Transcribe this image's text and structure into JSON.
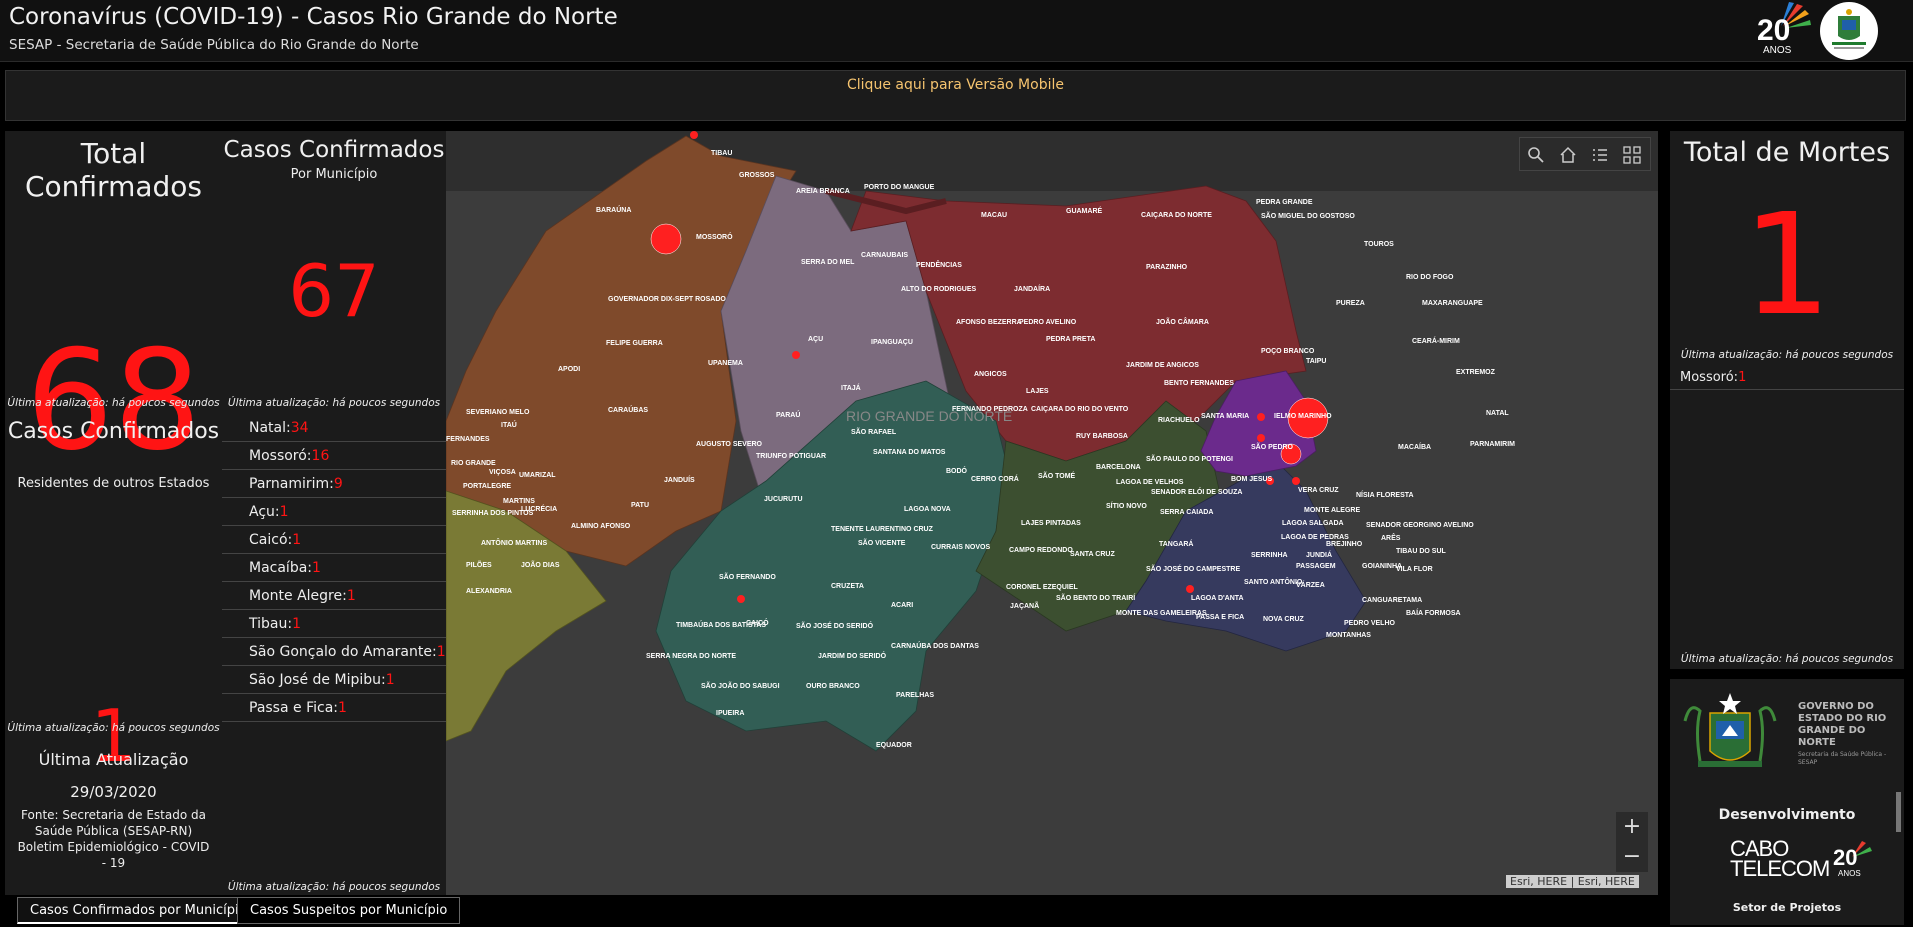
{
  "header": {
    "title": "Coronavírus (COVID-19) - Casos Rio Grande do Norte",
    "subtitle": "SESAP - Secretaria de Saúde Pública do Rio Grande do Norte",
    "logo_text": "20 ANOS"
  },
  "mobile_link": "Clique aqui para Versão Mobile",
  "total": {
    "title": "Total Confirmados",
    "value": "68",
    "update": "Última atualização: há poucos segundos"
  },
  "out_of_state": {
    "title": "Casos Confirmados",
    "subtitle": "Residentes de outros Estados",
    "value": "1",
    "update": "Última atualização: há poucos segundos"
  },
  "last_update": {
    "label": "Última Atualização",
    "date": "29/03/2020",
    "source": "Fonte: Secretaria de Estado da Saúde Pública (SESAP-RN) Boletim Epidemiológico - COVID - 19"
  },
  "municipio": {
    "title": "Casos Confirmados",
    "subtitle": "Por Município",
    "value": "67",
    "update": "Última atualização: há poucos segundos",
    "update_bottom": "Última atualização: há poucos segundos",
    "items": [
      {
        "name": "Natal:",
        "value": "34"
      },
      {
        "name": "Mossoró:",
        "value": "16"
      },
      {
        "name": "Parnamirim:",
        "value": "9"
      },
      {
        "name": "Açu:",
        "value": "1"
      },
      {
        "name": "Caicó:",
        "value": "1"
      },
      {
        "name": "Macaíba:",
        "value": "1"
      },
      {
        "name": "Monte Alegre:",
        "value": "1"
      },
      {
        "name": "Tibau:",
        "value": "1"
      },
      {
        "name": "São Gonçalo do Amarante:",
        "value": "1"
      },
      {
        "name": "São José de Mipibu:",
        "value": "1"
      },
      {
        "name": "Passa e Fica:",
        "value": "1"
      }
    ]
  },
  "deaths": {
    "title": "Total de Mortes",
    "value": "1",
    "update": "Última atualização: há poucos segundos",
    "item_name": "Mossoró:",
    "item_value": "1",
    "update_bottom": "Última atualização: há poucos segundos"
  },
  "dev": {
    "gov_text": "GOVERNO DO ESTADO DO RIO GRANDE DO NORTE",
    "gov_sub": "Secretaria da Saúde Pública - SESAP",
    "label": "Desenvolvimento",
    "cabo": "CABO",
    "telecom": "TELECOM",
    "anos": "20 ANOS",
    "sector": "Setor de Projetos"
  },
  "map": {
    "watermark": "RIO GRANDE DO NORTE",
    "attribution": "Esri, HERE | Esri, HERE",
    "icons": [
      "search-icon",
      "home-icon",
      "legend-icon",
      "basemap-icon"
    ],
    "cities": [
      "TIBAU",
      "GROSSOS",
      "AREIA BRANCA",
      "BARAÚNA",
      "MOSSORÓ",
      "SERRA DO MEL",
      "PORTO DO MANGUE",
      "MACAU",
      "GUAMARÉ",
      "CAIÇARA DO NORTE",
      "PEDRA GRANDE",
      "SÃO MIGUEL DO GOSTOSO",
      "TOUROS",
      "RIO DO FOGO",
      "MAXARANGUAPE",
      "CEARÁ-MIRIM",
      "EXTREMOZ",
      "NATAL",
      "PARNAMIRIM",
      "MACAÍBA",
      "CARNAUBAIS",
      "PENDÊNCIAS",
      "ALTO DO RODRIGUES",
      "AFONSO BEZERRA",
      "AÇU",
      "IPANGUAÇU",
      "ANGICOS",
      "ITAJÁ",
      "SÃO RAFAEL",
      "GOVERNADOR DIX-SEPT ROSADO",
      "FELIPE GUERRA",
      "APODI",
      "UPANEMA",
      "CARAÚBAS",
      "PARAÚ",
      "AUGUSTO SEVERO",
      "TRIUNFO POTIGUAR",
      "JANDUÍS",
      "PATU",
      "ALMINO AFONSO",
      "UMARIZAL",
      "MARTINS",
      "LUCRÉCIA",
      "VIÇOSA",
      "PORTALEGRE",
      "SERRINHA DOS PINTOS",
      "ANTÔNIO MARTINS",
      "JOÃO DIAS",
      "PILÕES",
      "ALEXANDRIA",
      "SEVERIANO MELO",
      "ITAÚ",
      "JUCURUTU",
      "SANTANA DO MATOS",
      "BODÓ",
      "CERRO CORÁ",
      "LAGOA NOVA",
      "TENENTE LAURENTINO CRUZ",
      "SÃO VICENTE",
      "CURRAIS NOVOS",
      "SÃO FERNANDO",
      "CRUZETA",
      "ACARI",
      "CAICÓ",
      "TIMBAÚBA DOS BATISTAS",
      "SÃO JOSÉ DO SERIDÓ",
      "SERRA NEGRA DO NORTE",
      "JARDIM DO SERIDÓ",
      "CARNAÚBA DOS DANTAS",
      "SÃO JOÃO DO SABUGI",
      "OURO BRANCO",
      "PARELHAS",
      "IPUEIRA",
      "EQUADOR",
      "JANDAÍRA",
      "PARAZINHO",
      "PUREZA",
      "PEDRO AVELINO",
      "JOÃO CÂMARA",
      "PEDRA PRETA",
      "POÇO BRANCO",
      "TAIPU",
      "JARDIM DE ANGICOS",
      "BENTO FERNANDES",
      "LAJES",
      "CAIÇARA DO RIO DO VENTO",
      "RIACHUELO",
      "SANTA MARIA",
      "IELMO MARINHO",
      "FERNANDO PEDROZA",
      "RUY BARBOSA",
      "SÃO PAULO DO POTENGI",
      "BARCELONA",
      "SÃO TOMÉ",
      "LAGOA DE VELHOS",
      "SENADOR ELÓI DE SOUZA",
      "SÃO PEDRO",
      "BOM JESUS",
      "SÍTIO NOVO",
      "SERRA CAIADA",
      "VERA CRUZ",
      "MONTE ALEGRE",
      "NÍSIA FLORESTA",
      "LAJES PINTADAS",
      "LAGOA SALGADA",
      "LAGOA DE PEDRAS",
      "BREJINHO",
      "SENADOR GEORGINO AVELINO",
      "ARÊS",
      "TANGARÁ",
      "CAMPO REDONDO",
      "SANTA CRUZ",
      "SERRINHA",
      "JUNDIÁ",
      "PASSAGEM",
      "GOIANINHA",
      "TIBAU DO SUL",
      "VILA FLOR",
      "SÃO JOSÉ DO CAMPESTRE",
      "SANTO ANTÔNIO",
      "VÁRZEA",
      "CORONEL EZEQUIEL",
      "SÃO BENTO DO TRAIRÍ",
      "JAÇANÃ",
      "LAGOA D'ANTA",
      "CANGUARETAMA",
      "MONTE DAS GAMELEIRAS",
      "PASSA E FICA",
      "NOVA CRUZ",
      "BAÍA FORMOSA",
      "PEDRO VELHO",
      "MONTANHAS",
      "RIO GRANDE",
      "FERNANDES"
    ]
  },
  "tabs": [
    "Casos Confirmados por Município",
    "Casos Suspeitos por Município"
  ]
}
